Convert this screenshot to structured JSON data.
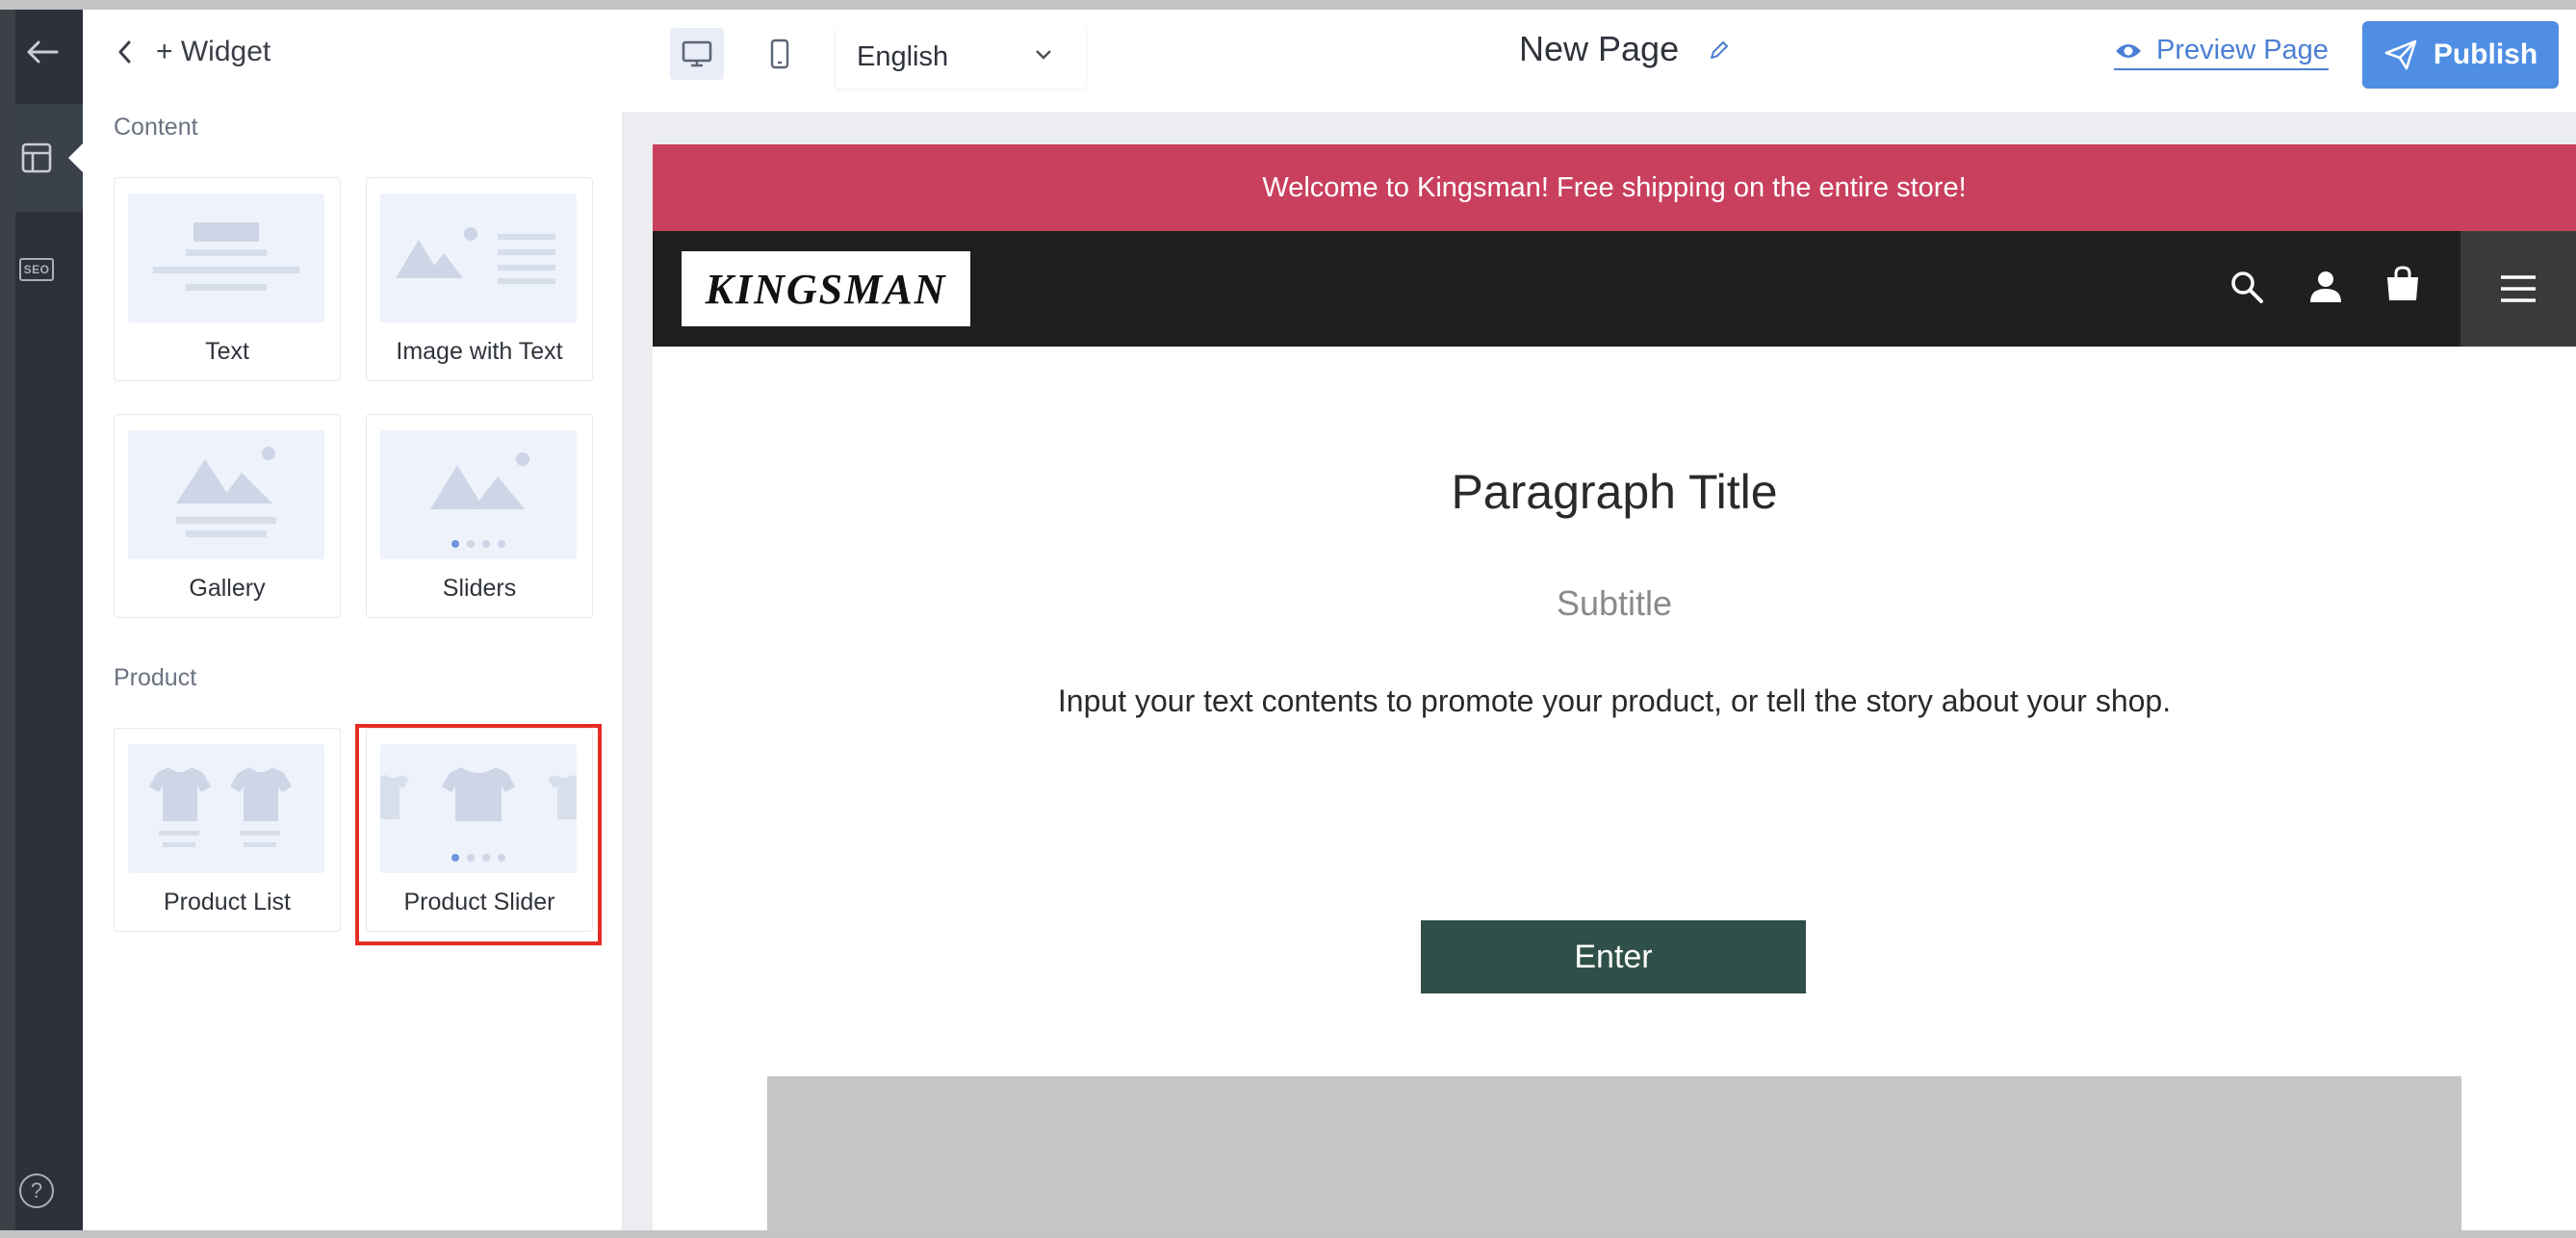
{
  "panel": {
    "title": "+ Widget",
    "sections": [
      {
        "label": "Content",
        "items": [
          {
            "label": "Text"
          },
          {
            "label": "Image with Text"
          },
          {
            "label": "Gallery"
          },
          {
            "label": "Sliders"
          }
        ]
      },
      {
        "label": "Product",
        "items": [
          {
            "label": "Product List"
          },
          {
            "label": "Product Slider"
          }
        ]
      }
    ]
  },
  "rail": {
    "seo_label": "SEO",
    "help_label": "?"
  },
  "topbar": {
    "language": "English",
    "page_title": "New Page",
    "preview_label": "Preview Page",
    "publish_label": "Publish"
  },
  "site": {
    "announcement": "Welcome to Kingsman! Free shipping on the entire store!",
    "logo_text": "KINGSMAN",
    "paragraph_title": "Paragraph Title",
    "subtitle": "Subtitle",
    "body": "Input your text contents to promote your product, or tell the story about your shop.",
    "button_label": "Enter"
  },
  "colors": {
    "rail": "#2c313a",
    "accent": "#4f8ee3",
    "announcement": "#c9405e",
    "store_bar": "#1f1f1f",
    "enter_button": "#2f5048",
    "highlight": "#e52d23"
  },
  "state": {
    "active_device": "desktop",
    "highlighted_widget": "Product Slider"
  }
}
